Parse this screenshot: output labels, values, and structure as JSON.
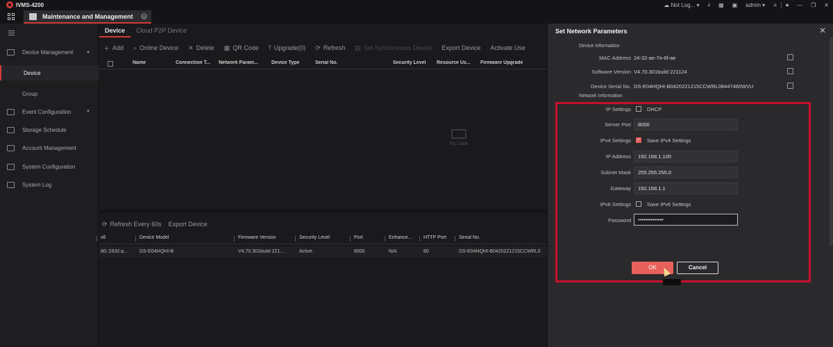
{
  "app": {
    "title": "IVMS-4200"
  },
  "titlebar": {
    "status": "Not Log...",
    "user": "admin"
  },
  "main_tab": {
    "label": "Maintenance and Management"
  },
  "sidebar": {
    "items": [
      {
        "label": "Device Management"
      },
      {
        "label": "Device"
      },
      {
        "label": "Group"
      },
      {
        "label": "Event Configuration"
      },
      {
        "label": "Storage Schedule"
      },
      {
        "label": "Account Management"
      },
      {
        "label": "System Configuration"
      },
      {
        "label": "System Log"
      }
    ]
  },
  "content": {
    "tabs": [
      "Device",
      "Cloud P2P Device"
    ],
    "toolbar": [
      "Add",
      "Online Device",
      "Delete",
      "QR Code",
      "Upgrade(0)",
      "Refresh",
      "Set Synchronous Device",
      "Export Device",
      "Activate Use"
    ],
    "columns": [
      "Name",
      "Connection T...",
      "Network Param...",
      "Device Type",
      "Serial No.",
      "Security Level",
      "Resource Us...",
      "Firmware Upgrade"
    ],
    "no_data": "No Data",
    "online": {
      "refresh_label": "Refresh Every 60s",
      "export_label": "Export Device",
      "columns": [
        "v6",
        "Device Model",
        "Firmware Version",
        "Security Level",
        "Port",
        "Enhance...",
        "HTTP Port",
        "Serial No."
      ],
      "row": [
        "80::2632:a...",
        "DS-E04HQHI-B",
        "V4.70.301build 221...",
        "Active",
        "8000",
        "N/A",
        "80",
        "DS-E04HQHI-B0420221215CCWRL0"
      ]
    }
  },
  "dialog": {
    "title": "Set Network Parameters",
    "device_info_head": "Device Information",
    "mac_label": "MAC Address",
    "mac_value": "24-32-ae-7e-6f-ae",
    "sw_label": "Software Version",
    "sw_value": "V4.70.301build 221124",
    "serial_label": "Device Serial No.",
    "serial_value": "DS-E04HQHI-B0420221215CCWRL08447460WVU",
    "network_info_head": "Network Information",
    "ip_settings_label": "IP Settings",
    "dhcp_label": "DHCP",
    "server_port_label": "Server Port",
    "server_port_value": "8000",
    "ipv4_settings_label": "IPv4 Settings",
    "save_ipv4_label": "Save IPv4 Settings",
    "ip_label": "IP Address",
    "ip_value": "192.168.1.100",
    "mask_label": "Subnet Mask",
    "mask_value": "255.255.255.0",
    "gw_label": "Gateway",
    "gw_value": "192.168.1.1",
    "ipv6_settings_label": "IPv6 Settings",
    "save_ipv6_label": "Save IPv6 Settings",
    "password_label": "Password",
    "password_value": "••••••••••••••",
    "ok_label": "OK",
    "cancel_label": "Cancel",
    "dhcp_checked": false,
    "save_ipv4_checked": true,
    "save_ipv6_checked": false
  },
  "colors": {
    "accent": "#d43a3a",
    "highlight": "#c8102e",
    "ok_button": "#e8605a"
  }
}
